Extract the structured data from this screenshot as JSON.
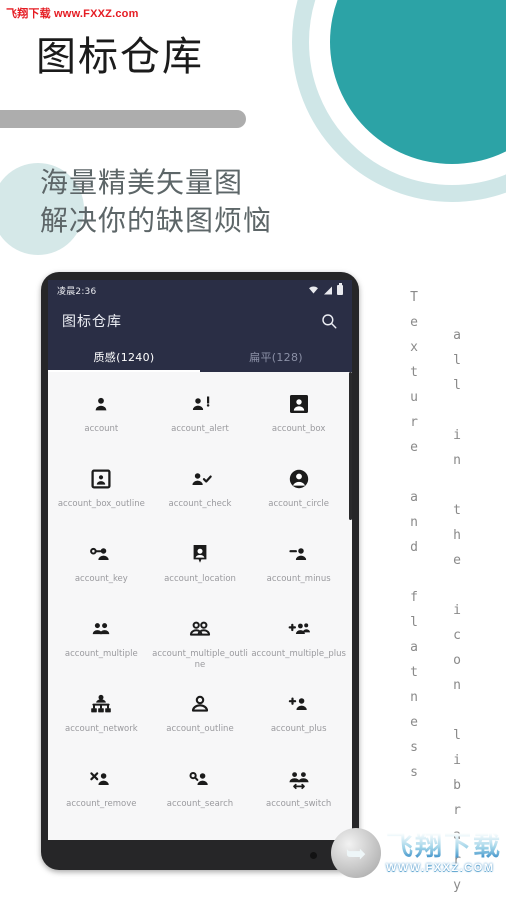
{
  "watermark_top": "飞翔下载 www.FXXZ.com",
  "page_title": "图标仓库",
  "subtitle": "海量精美矢量图\n解决你的缺图烦恼",
  "vertical_text": {
    "column_1": "Texture\nand\nflatness",
    "column_2": "all in\nthe\nicon\nlibrary",
    "column_1_chars": "T\ne\nx\nt\nu\nr\ne\n\na\nn\nd\n\nf\nl\na\nt\nn\ne\ns\ns",
    "column_2_chars": "a\nl\nl\n\ni\nn\n\nt\nh\ne\n\ni\nc\no\nn\n\nl\ni\nb\nr\na\nr\ny"
  },
  "phone": {
    "status_bar": {
      "time": "凌晨2:36",
      "icons": [
        "wifi-icon",
        "signal-icon",
        "battery-icon"
      ]
    },
    "app_bar": {
      "title": "图标仓库",
      "search_icon": "search-icon"
    },
    "tabs": [
      {
        "label": "质感(1240)",
        "active": true
      },
      {
        "label": "扁平(128)",
        "active": false
      }
    ],
    "icons": [
      {
        "name": "account",
        "glyph": "account"
      },
      {
        "name": "account_alert",
        "glyph": "account_alert"
      },
      {
        "name": "account_box",
        "glyph": "account_box"
      },
      {
        "name": "account_box_outline",
        "glyph": "account_box_outline"
      },
      {
        "name": "account_check",
        "glyph": "account_check"
      },
      {
        "name": "account_circle",
        "glyph": "account_circle"
      },
      {
        "name": "account_key",
        "glyph": "account_key"
      },
      {
        "name": "account_location",
        "glyph": "account_location"
      },
      {
        "name": "account_minus",
        "glyph": "account_minus"
      },
      {
        "name": "account_multiple",
        "glyph": "account_multiple"
      },
      {
        "name": "account_multiple_outline",
        "glyph": "account_multiple_outline"
      },
      {
        "name": "account_multiple_plus",
        "glyph": "account_multiple_plus"
      },
      {
        "name": "account_network",
        "glyph": "account_network"
      },
      {
        "name": "account_outline",
        "glyph": "account_outline"
      },
      {
        "name": "account_plus",
        "glyph": "account_plus"
      },
      {
        "name": "account_remove",
        "glyph": "account_remove"
      },
      {
        "name": "account_search",
        "glyph": "account_search"
      },
      {
        "name": "account_switch",
        "glyph": "account_switch"
      }
    ]
  },
  "watermark_bottom": {
    "cn": "飞翔下载",
    "en": "WWW.FXXZ.COM",
    "logo": "feixiang-logo"
  },
  "colors": {
    "teal": "#2ca3a6",
    "teal_light": "#cfe6e7",
    "teal_blob": "#d5e8e8",
    "appbar": "#2a2e45",
    "grey_bar": "#adadad",
    "watermark_red": "#e51c23",
    "screen_bg": "#f7f7f8"
  }
}
